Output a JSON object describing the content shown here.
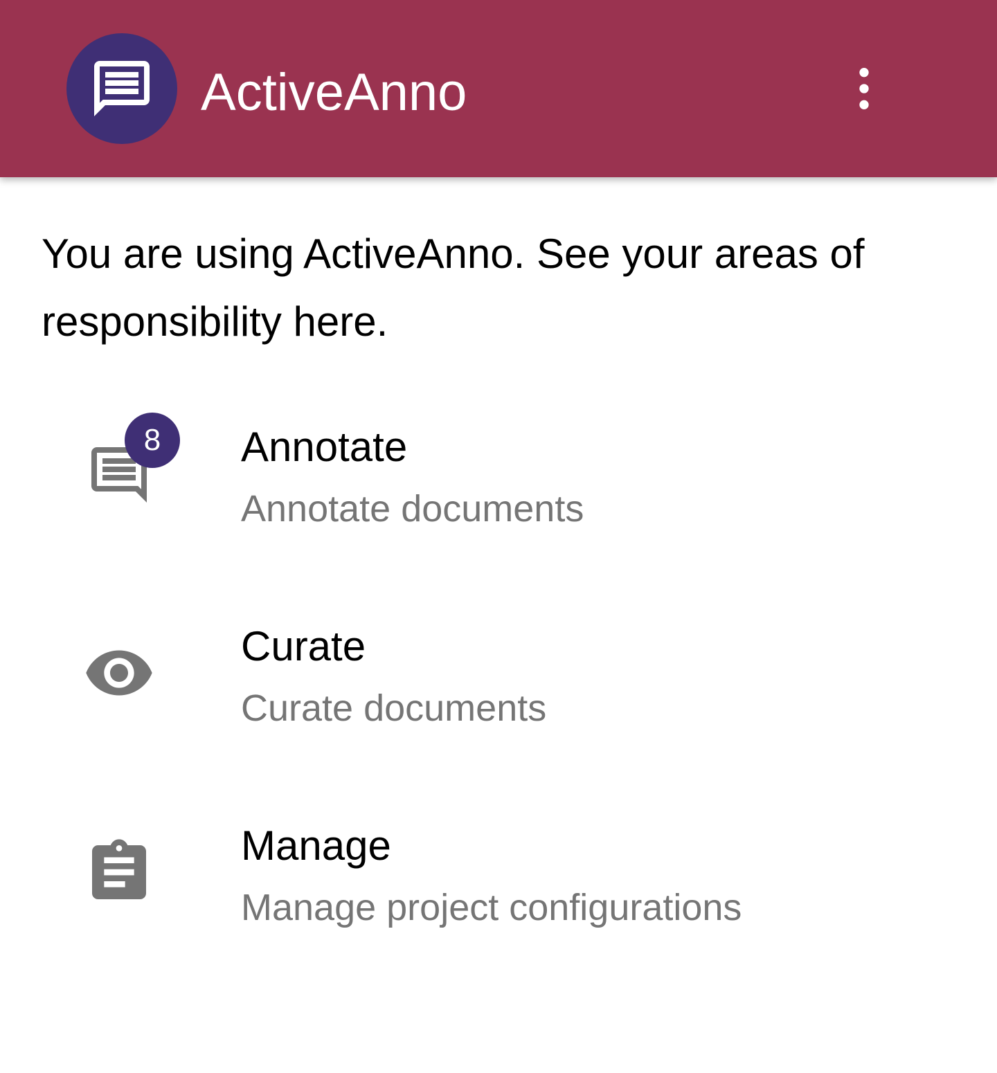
{
  "theme": {
    "appbar_color": "#9a3350",
    "accent_color": "#3f2f75",
    "icon_color": "#757575"
  },
  "appbar": {
    "title": "ActiveAnno",
    "logo_icon": "chat-bubble-icon",
    "menu_icon": "more-vert-icon"
  },
  "intro_text": "You are using ActiveAnno. See your areas of responsibility here.",
  "nav_items": [
    {
      "label": "Annotate",
      "description": "Annotate documents",
      "icon": "chat-bubble-icon",
      "badge": "8"
    },
    {
      "label": "Curate",
      "description": "Curate documents",
      "icon": "eye-icon"
    },
    {
      "label": "Manage",
      "description": "Manage project configurations",
      "icon": "clipboard-icon"
    }
  ]
}
